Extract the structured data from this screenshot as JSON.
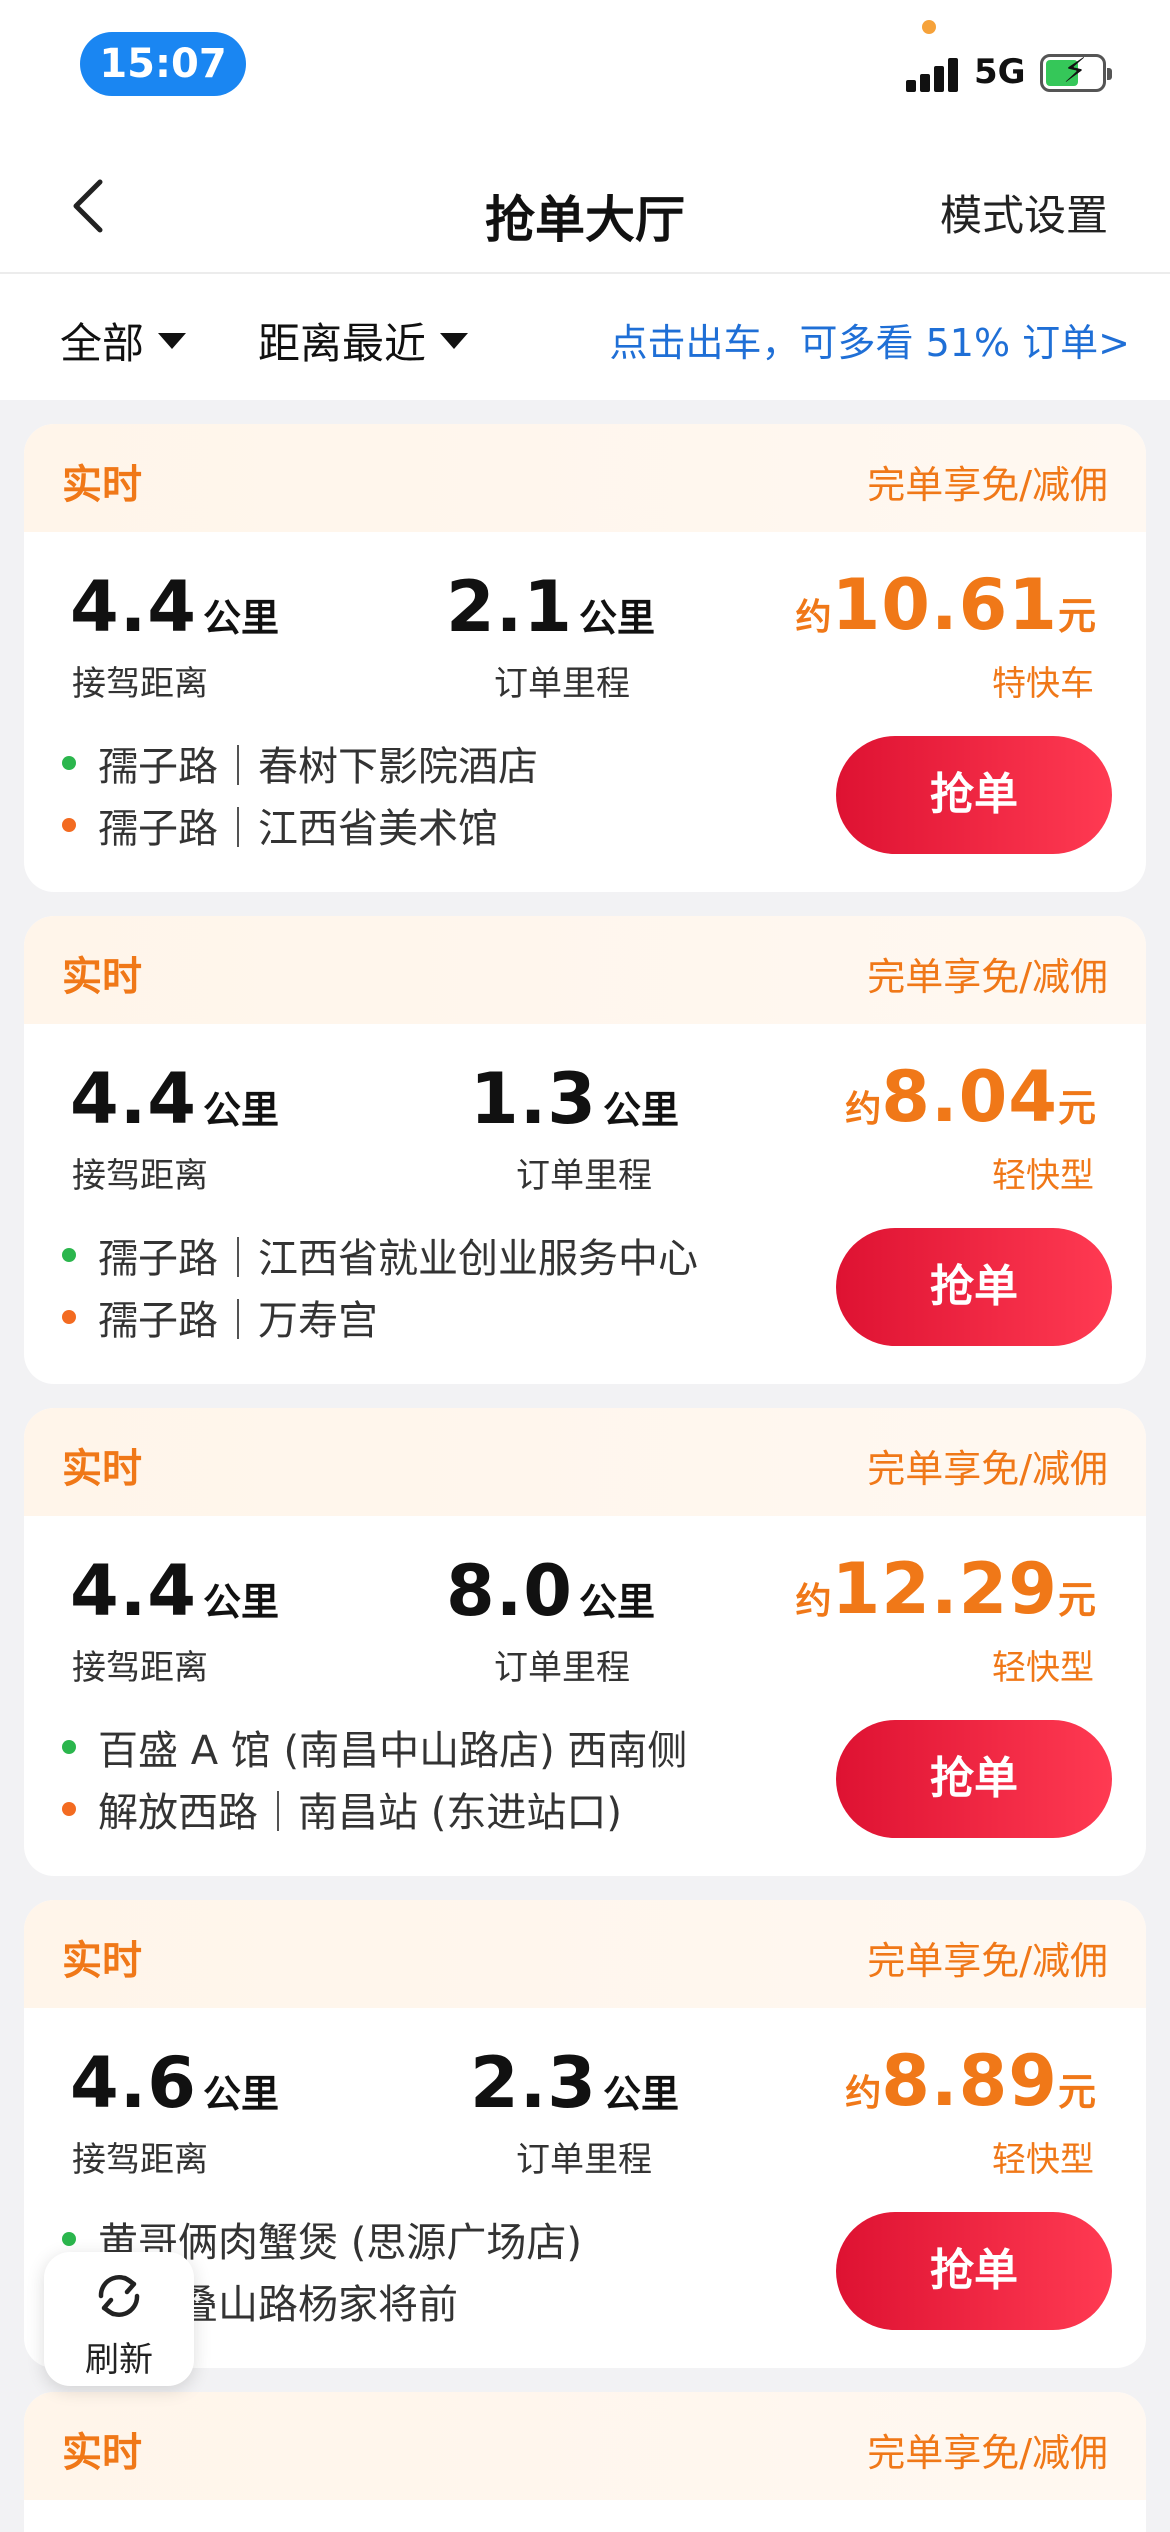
{
  "status_bar": {
    "time": "15:07",
    "network": "5G",
    "battery_icon": "battery-charging-icon",
    "signal_icon": "signal-icon"
  },
  "nav": {
    "title": "抢单大厅",
    "right_action": "模式设置",
    "back_icon": "chevron-left-icon"
  },
  "filters": {
    "category": "全部",
    "sort": "距离最近",
    "promo": "点击出车，可多看 51% 订单>"
  },
  "orders": [
    {
      "tag": "实时",
      "benefit": "完单享免/减佣",
      "pickup_distance": "4.4",
      "pickup_unit": "公里",
      "pickup_label": "接驾距离",
      "trip_distance": "2.1",
      "trip_unit": "公里",
      "trip_label": "订单里程",
      "price_prefix": "约",
      "price": "10.61",
      "price_unit": "元",
      "car_type": "特快车",
      "from": "孺子路｜春树下影院酒店",
      "to": "孺子路｜江西省美术馆",
      "button": "抢单"
    },
    {
      "tag": "实时",
      "benefit": "完单享免/减佣",
      "pickup_distance": "4.4",
      "pickup_unit": "公里",
      "pickup_label": "接驾距离",
      "trip_distance": "1.3",
      "trip_unit": "公里",
      "trip_label": "订单里程",
      "price_prefix": "约",
      "price": "8.04",
      "price_unit": "元",
      "car_type": "轻快型",
      "from": "孺子路｜江西省就业创业服务中心",
      "to": "孺子路｜万寿宫",
      "button": "抢单"
    },
    {
      "tag": "实时",
      "benefit": "完单享免/减佣",
      "pickup_distance": "4.4",
      "pickup_unit": "公里",
      "pickup_label": "接驾距离",
      "trip_distance": "8.0",
      "trip_unit": "公里",
      "trip_label": "订单里程",
      "price_prefix": "约",
      "price": "12.29",
      "price_unit": "元",
      "car_type": "轻快型",
      "from": "百盛 A 馆 (南昌中山路店) 西南侧",
      "to": "解放西路｜南昌站 (东进站口)",
      "button": "抢单"
    },
    {
      "tag": "实时",
      "benefit": "完单享免/减佣",
      "pickup_distance": "4.6",
      "pickup_unit": "公里",
      "pickup_label": "接驾距离",
      "trip_distance": "2.3",
      "trip_unit": "公里",
      "trip_label": "订单里程",
      "price_prefix": "约",
      "price": "8.89",
      "price_unit": "元",
      "car_type": "轻快型",
      "from": "黄哥俩肉蟹煲 (思源广场店)",
      "to": "乔｜叠山路杨家将前",
      "button": "抢单"
    },
    {
      "tag": "实时",
      "benefit": "完单享免/减佣"
    }
  ],
  "refresh": {
    "label": "刷新",
    "icon": "refresh-icon"
  },
  "colors": {
    "accent_orange": "#f07818",
    "button_red": "#de1232",
    "link_blue": "#1f6fd6",
    "time_pill": "#1a86f2"
  }
}
